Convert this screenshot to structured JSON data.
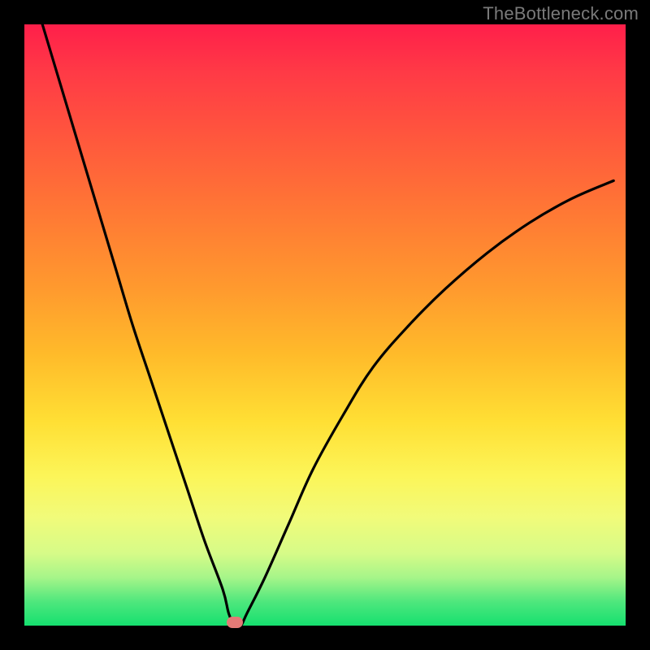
{
  "watermark": "TheBottleneck.com",
  "chart_data": {
    "type": "line",
    "title": "",
    "xlabel": "",
    "ylabel": "",
    "xlim": [
      0,
      100
    ],
    "ylim": [
      0,
      100
    ],
    "grid": false,
    "legend": false,
    "background_gradient": {
      "direction": "vertical",
      "stops": [
        "#ff1f4a",
        "#ff7a34",
        "#ffdf34",
        "#f1fb7a",
        "#15e06f"
      ]
    },
    "series": [
      {
        "name": "bottleneck-curve",
        "color": "#000000",
        "x": [
          3,
          6,
          9,
          12,
          15,
          18,
          21,
          24,
          27,
          30,
          33,
          34,
          35,
          36,
          37,
          40,
          44,
          48,
          53,
          58,
          64,
          70,
          77,
          84,
          91,
          98
        ],
        "y": [
          100,
          90,
          80,
          70,
          60,
          50,
          41,
          32,
          23,
          14,
          6,
          2,
          0,
          0,
          2,
          8,
          17,
          26,
          35,
          43,
          50,
          56,
          62,
          67,
          71,
          74
        ]
      }
    ],
    "marker": {
      "x": 35,
      "y": 0.5,
      "color": "#e47a76"
    }
  }
}
